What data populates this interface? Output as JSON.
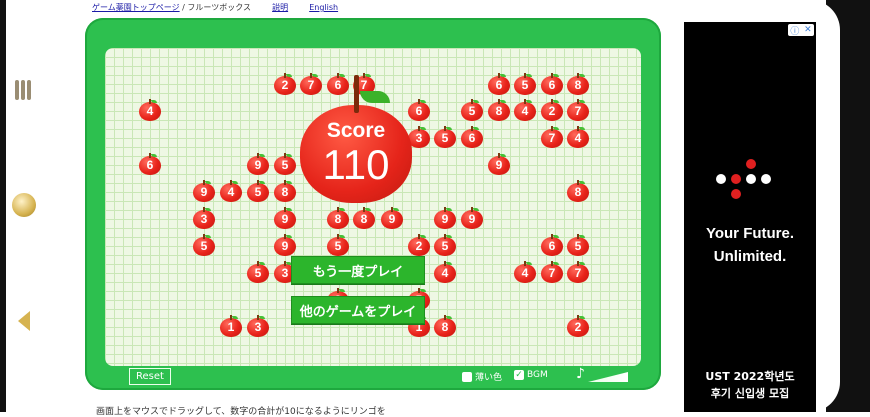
{
  "breadcrumb": {
    "home": "ゲーム薬園トップページ",
    "sep": " / ",
    "current": "フルーツボックス",
    "help": "説明",
    "lang": "English"
  },
  "score": {
    "label": "Score",
    "value": "110"
  },
  "buttons": {
    "replay": "もう一度プレイ",
    "other": "他のゲームをプレイ",
    "reset": "Reset"
  },
  "options": {
    "light_label": "薄い色",
    "bgm_label": "BGM",
    "light_checked": false,
    "bgm_checked": true
  },
  "instruction": "画面上をマウスでドラッグして、数字の合計が10になるようにリンゴを",
  "ad": {
    "headline_1": "Your Future.",
    "headline_2": "Unlimited.",
    "sub_1": "UST 2022학년도",
    "sub_2": "후기 신입생 모집"
  },
  "apples": [
    {
      "v": "2"
    },
    {
      "v": "7"
    },
    {
      "v": "6"
    },
    {
      "v": "7"
    },
    {
      "v": "6"
    },
    {
      "v": "5"
    },
    {
      "v": "6"
    },
    {
      "v": "8"
    },
    {
      "v": "4"
    },
    {
      "v": "6"
    },
    {
      "v": "5"
    },
    {
      "v": "8"
    },
    {
      "v": "4"
    },
    {
      "v": "2"
    },
    {
      "v": "7"
    },
    {
      "v": "3"
    },
    {
      "v": "5"
    },
    {
      "v": "6"
    },
    {
      "v": "7"
    },
    {
      "v": "4"
    },
    {
      "v": "6"
    },
    {
      "v": "9"
    },
    {
      "v": "5"
    },
    {
      "v": "9"
    },
    {
      "v": "9"
    },
    {
      "v": "4"
    },
    {
      "v": "5"
    },
    {
      "v": "8"
    },
    {
      "v": "8"
    },
    {
      "v": "3"
    },
    {
      "v": "9"
    },
    {
      "v": "8"
    },
    {
      "v": "8"
    },
    {
      "v": "9"
    },
    {
      "v": "9"
    },
    {
      "v": "9"
    },
    {
      "v": "5"
    },
    {
      "v": "9"
    },
    {
      "v": "5"
    },
    {
      "v": "2"
    },
    {
      "v": "5"
    },
    {
      "v": "6"
    },
    {
      "v": "5"
    },
    {
      "v": "5"
    },
    {
      "v": "3"
    },
    {
      "v": "4"
    },
    {
      "v": "4"
    },
    {
      "v": "7"
    },
    {
      "v": "7"
    },
    {
      "v": "3"
    },
    {
      "v": "5"
    },
    {
      "v": "1"
    },
    {
      "v": "3"
    },
    {
      "v": "1"
    },
    {
      "v": "8"
    },
    {
      "v": "2"
    }
  ]
}
